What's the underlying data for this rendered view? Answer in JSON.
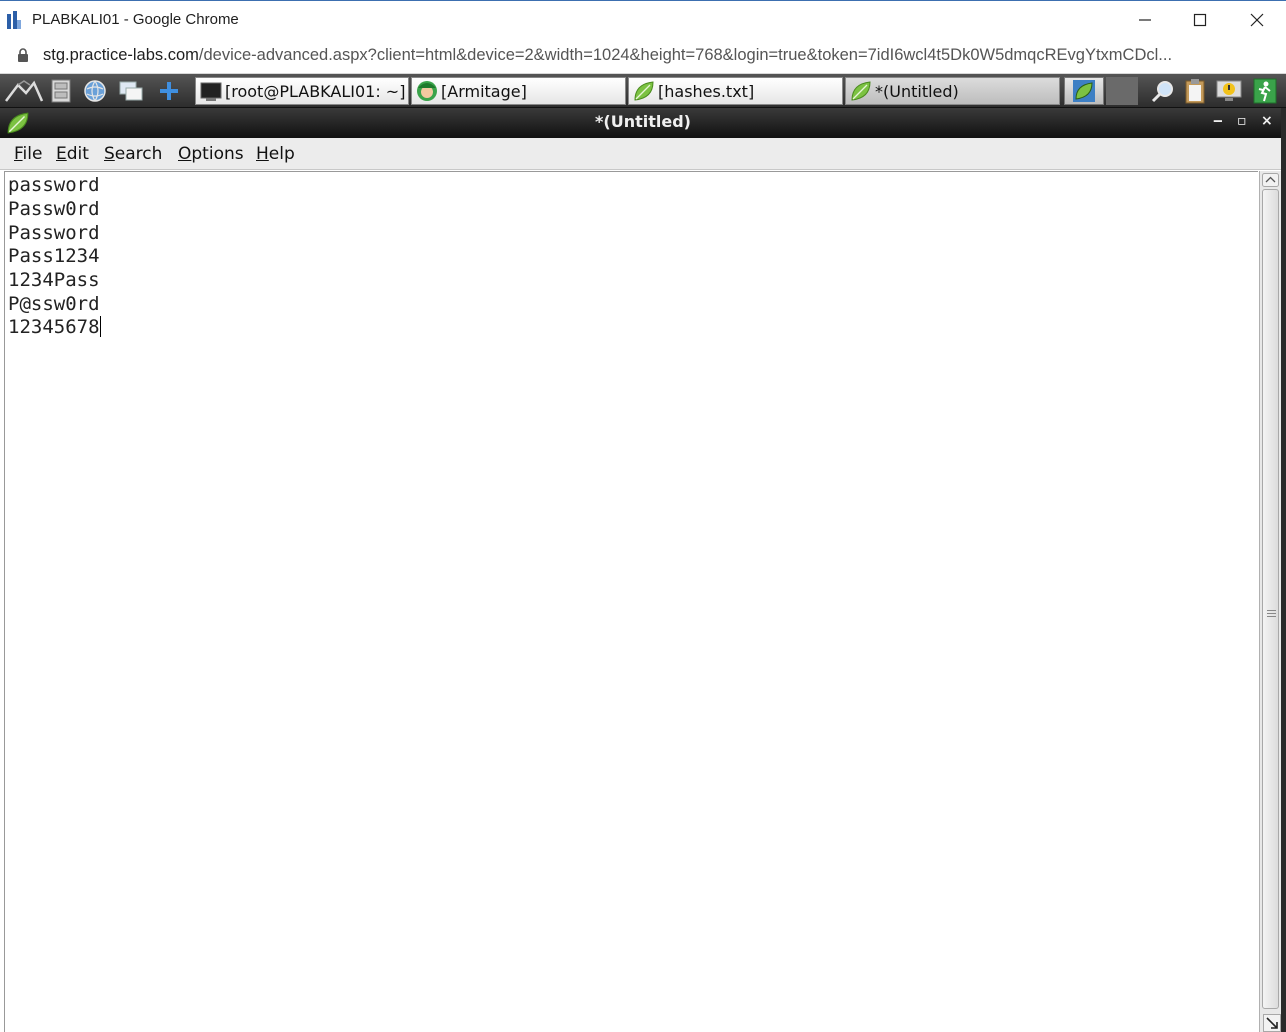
{
  "browser": {
    "title": "PLABKALI01 - Google Chrome",
    "url_host": "stg.practice-labs.com",
    "url_rest": "/device-advanced.aspx?client=html&device=2&width=1024&height=768&login=true&token=7idI6wcl4t5Dk0W5dmqcREvgYtxmCDcl..."
  },
  "taskbar": {
    "tasks": [
      {
        "label": "[root@PLABKALI01: ~]",
        "icon": "terminal-icon"
      },
      {
        "label": "[Armitage]",
        "icon": "armitage-icon"
      },
      {
        "label": "[hashes.txt]",
        "icon": "gedit-leaf-icon"
      },
      {
        "label": "*(Untitled)",
        "icon": "gedit-leaf-icon"
      }
    ]
  },
  "window": {
    "title": "*(Untitled)",
    "minimize": "‒",
    "maximize": "▫",
    "close": "×"
  },
  "menu": {
    "file": {
      "mnemonic": "F",
      "rest": "ile"
    },
    "edit": {
      "mnemonic": "E",
      "rest": "dit"
    },
    "search": {
      "mnemonic": "S",
      "rest": "earch"
    },
    "options": {
      "mnemonic": "O",
      "rest": "ptions"
    },
    "help": {
      "mnemonic": "H",
      "rest": "elp"
    }
  },
  "editor": {
    "lines": [
      "password",
      "Passw0rd",
      "Password",
      "Pass1234",
      "1234Pass",
      "P@ssw0rd",
      "12345678"
    ]
  },
  "colors": {
    "panel": "#2d2d2d",
    "leaf_green": "#7cc242",
    "menu_bg": "#ececec"
  }
}
